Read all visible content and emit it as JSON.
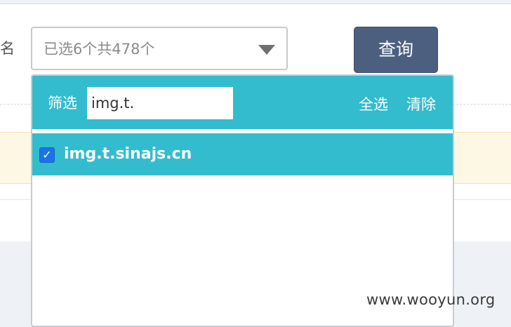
{
  "form": {
    "field_label": "名",
    "select_value": "已选6个共478个",
    "query_button": "查询"
  },
  "dropdown": {
    "filter_label": "筛选",
    "filter_value": "img.t.",
    "select_all": "全选",
    "clear": "清除",
    "options": [
      {
        "label": "img.t.sinajs.cn",
        "checked": true,
        "check_glyph": "✓"
      }
    ]
  },
  "watermark": "www.wooyun.org",
  "colors": {
    "accent_teal": "#33bccd",
    "button_navy": "#4c5f7f",
    "checkbox_blue": "#1a73e8"
  }
}
